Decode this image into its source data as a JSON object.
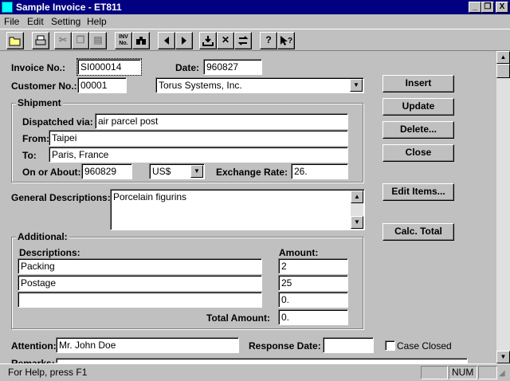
{
  "window": {
    "title": "Sample Invoice - ET811"
  },
  "title_buttons": {
    "minimize": "_",
    "restore": "❐",
    "close": "X"
  },
  "menu": [
    {
      "label": "File"
    },
    {
      "label": "Edit"
    },
    {
      "label": "Setting"
    },
    {
      "label": "Help"
    }
  ],
  "toolbar": {
    "inv_label_1": "INV",
    "inv_label_2": "No."
  },
  "form": {
    "invoice_no_label": "Invoice No.:",
    "invoice_no": "SI000014",
    "date_label": "Date:",
    "date": "960827",
    "customer_no_label": "Customer No.:",
    "customer_no": "00001",
    "customer_name": "Torus Systems, Inc.",
    "shipment_title": "Shipment",
    "dispatched_label": "Dispatched via:",
    "dispatched": "air parcel post",
    "from_label": "From:",
    "from": "Taipei",
    "to_label": "To:",
    "to": "Paris, France",
    "on_about_label": "On or About:",
    "on_about": "960829",
    "currency": "US$",
    "exchange_label": "Exchange Rate:",
    "exchange": "26.",
    "general_label": "General Descriptions:",
    "general": "Porcelain figurins",
    "additional_title": "Additional:",
    "desc_header": "Descriptions:",
    "amount_header": "Amount:",
    "rows": [
      {
        "desc": "Packing",
        "amount": "2"
      },
      {
        "desc": "Postage",
        "amount": "25"
      },
      {
        "desc": "",
        "amount": "0."
      }
    ],
    "total_label": "Total Amount:",
    "total": "0.",
    "attention_label": "Attention:",
    "attention": "Mr. John Doe",
    "response_label": "Response Date:",
    "response": "",
    "case_closed_label": "Case Closed",
    "remarks_label": "Remarks:"
  },
  "buttons": {
    "insert": "Insert",
    "update": "Update",
    "delete": "Delete...",
    "close": "Close",
    "edit_items": "Edit Items...",
    "calc_total": "Calc. Total"
  },
  "status": {
    "help": "For Help, press F1",
    "num": "NUM"
  }
}
